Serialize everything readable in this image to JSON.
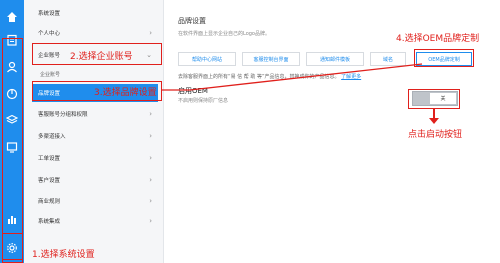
{
  "rail": {
    "icons": [
      "home-icon",
      "clipboard-icon",
      "user-icon",
      "chart-icon",
      "layers-icon",
      "device-icon",
      "bar-chart-icon",
      "gear-icon"
    ]
  },
  "nav": {
    "heading": "系统设置",
    "personal": "个人中心",
    "enterprise": "企业账号",
    "enterprise_sub": "企业账号",
    "brand": "品牌设置",
    "service_group": "客服账号分组和权限",
    "multi_channel": "多渠道接入",
    "workorder": "工单设置",
    "customer": "客户设置",
    "business_rule": "商业规则",
    "integration": "系统集成"
  },
  "main": {
    "title": "品牌设置",
    "description": "在软件界面上显示企业自己的Logo品牌。",
    "tabs": [
      "帮助中心网站",
      "客服控制台界面",
      "通知邮件模板",
      "域名",
      "OEM品牌定制"
    ],
    "notice_prefix": "去除客服界面上的所有“易 信 帮 助 等”产品信息，替换成你的产品信息。",
    "notice_link": "了解更多",
    "oem_title": "启用OEM",
    "oem_desc": "不启用则保持原厂信息",
    "toggle_label": "关"
  },
  "annotations": {
    "step1": "1.选择系统设置",
    "step2": "2.选择企业账号",
    "step3": "3.选择品牌设置",
    "step4": "4.选择OEM品牌定制",
    "step5": "点击启动按钮"
  },
  "colors": {
    "accent": "#1f8ded",
    "annotation": "#e0201c"
  }
}
